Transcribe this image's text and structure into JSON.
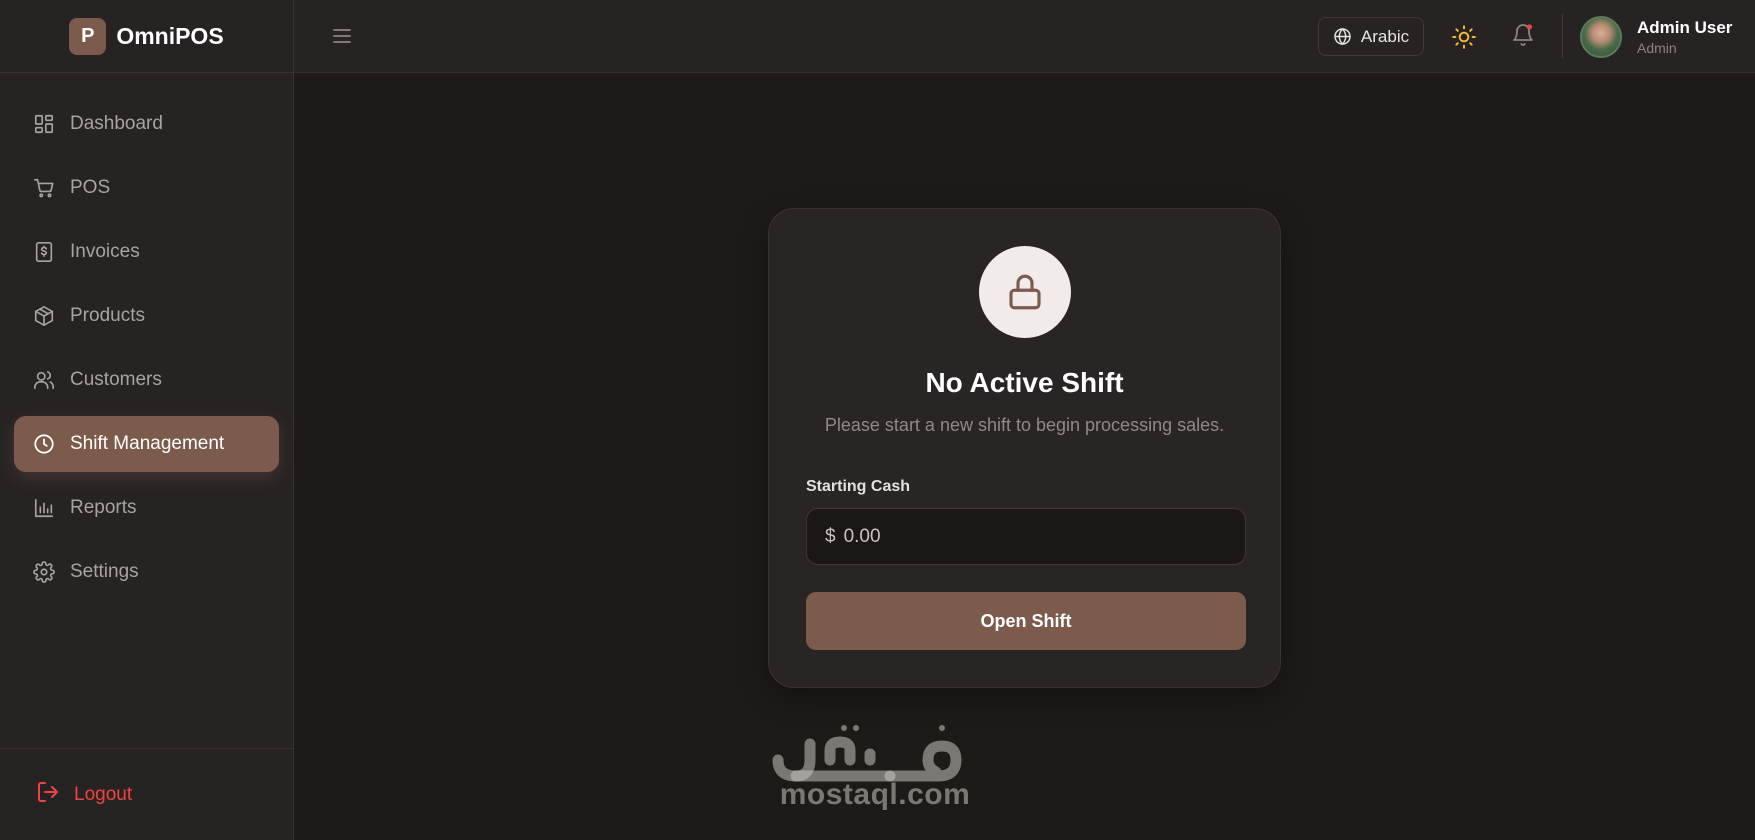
{
  "brand": {
    "logo_letter": "P",
    "name": "OmniPOS"
  },
  "sidebar": {
    "items": [
      {
        "label": "Dashboard",
        "icon": "dashboard-icon"
      },
      {
        "label": "POS",
        "icon": "cart-icon"
      },
      {
        "label": "Invoices",
        "icon": "invoice-icon"
      },
      {
        "label": "Products",
        "icon": "package-icon"
      },
      {
        "label": "Customers",
        "icon": "users-icon"
      },
      {
        "label": "Shift Management",
        "icon": "clock-icon",
        "active": true
      },
      {
        "label": "Reports",
        "icon": "bar-chart-icon"
      },
      {
        "label": "Settings",
        "icon": "gear-icon"
      }
    ],
    "logout_label": "Logout"
  },
  "header": {
    "language_label": "Arabic",
    "user_name": "Admin User",
    "user_role": "Admin"
  },
  "shift_card": {
    "title": "No Active Shift",
    "subtitle": "Please start a new shift to begin processing sales.",
    "field_label": "Starting Cash",
    "currency_symbol": "$",
    "cash_placeholder": "0.00",
    "open_button_label": "Open Shift"
  },
  "watermark": {
    "text": "mostaql.com"
  },
  "colors": {
    "accent": "#7c5a4c",
    "background": "#1e1a18",
    "panel": "#272322",
    "danger": "#ef4444",
    "sun": "#f5b83d",
    "notification_dot": "#ef4444"
  }
}
